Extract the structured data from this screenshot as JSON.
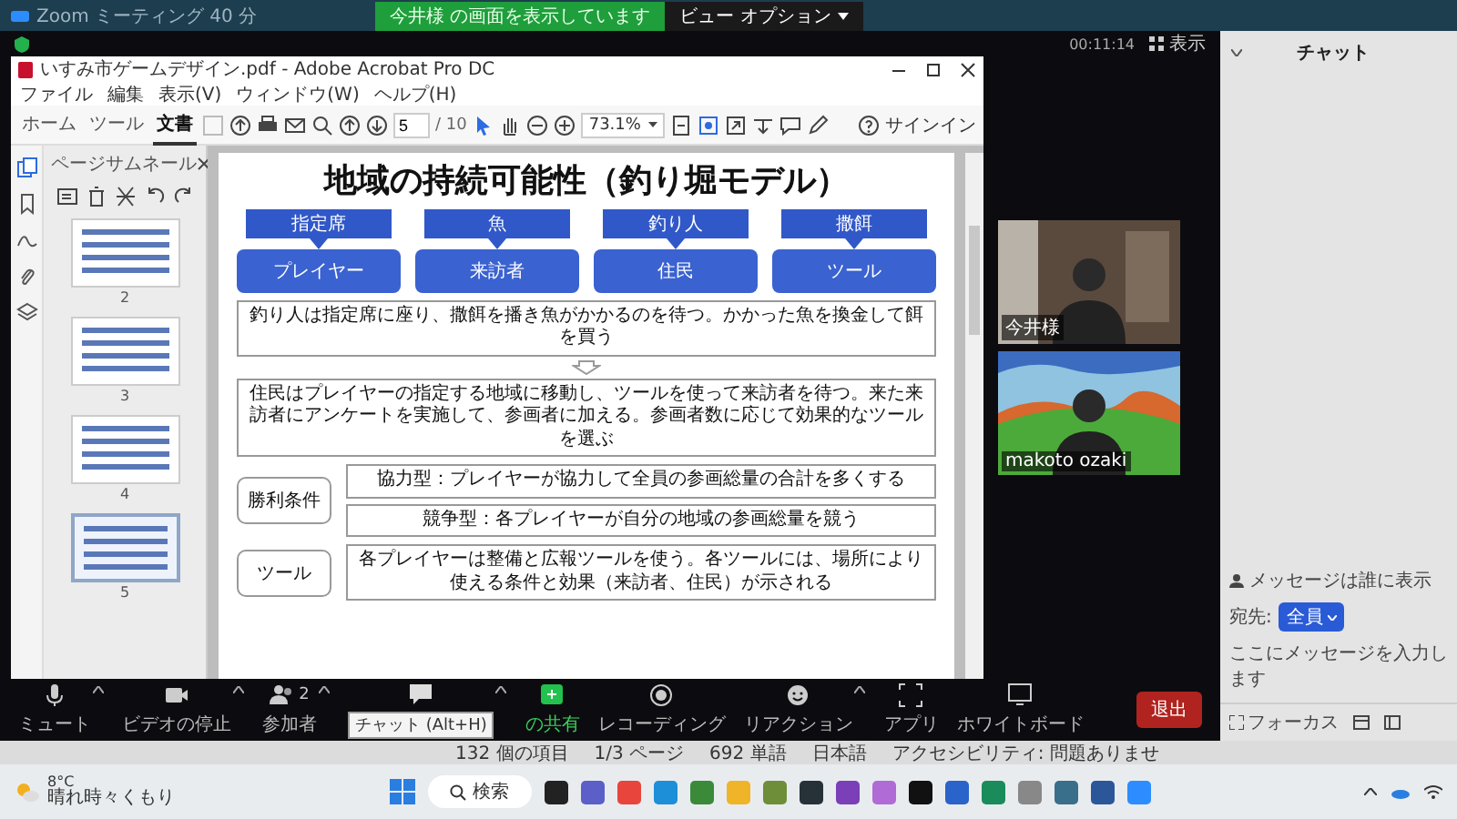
{
  "zoom": {
    "title": "Zoom ミーティング 40 分",
    "banner": "今井様 の画面を表示しています",
    "view_options": "ビュー オプション",
    "timer": "00:11:14",
    "view": "表示"
  },
  "acrobat": {
    "title": "いすみ市ゲームデザイン.pdf - Adobe Acrobat Pro DC",
    "menu": [
      "ファイル",
      "編集",
      "表示(V)",
      "ウィンドウ(W)",
      "ヘルプ(H)"
    ],
    "tabs": [
      {
        "label": "ホーム",
        "selected": false
      },
      {
        "label": "ツール",
        "selected": false
      },
      {
        "label": "文書",
        "selected": true
      }
    ],
    "page_current": "5",
    "page_total": "/ 10",
    "zoom_level": "73.1%",
    "sign_in": "サインイン",
    "sidebar_title": "ページサムネール",
    "thumbnails": [
      {
        "number": "2",
        "selected": false
      },
      {
        "number": "3",
        "selected": false
      },
      {
        "number": "4",
        "selected": false
      },
      {
        "number": "5",
        "selected": true
      }
    ]
  },
  "slide": {
    "title": "地域の持続可能性（釣り堀モデル）",
    "mappings": [
      {
        "from": "指定席",
        "to": "プレイヤー"
      },
      {
        "from": "魚",
        "to": "来訪者"
      },
      {
        "from": "釣り人",
        "to": "住民"
      },
      {
        "from": "撒餌",
        "to": "ツール"
      }
    ],
    "sentences": [
      "釣り人は指定席に座り、撒餌を播き魚がかかるのを待つ。かかった魚を換金して餌を買う",
      "住民はプレイヤーの指定する地域に移動し、ツールを使って来訪者を待つ。来た来訪者にアンケートを実施して、参画者に加える。参画者数に応じて効果的なツールを選ぶ"
    ],
    "conditions": [
      {
        "label": "勝利条件",
        "items": [
          "協力型：プレイヤーが協力して全員の参画総量の合計を多くする",
          "競争型：各プレイヤーが自分の地域の参画総量を競う"
        ]
      },
      {
        "label": "ツール",
        "items": [
          "各プレイヤーは整備と広報ツールを使う。各ツールには、場所により使える条件と効果（来訪者、住民）が示される"
        ]
      }
    ]
  },
  "video_tiles": [
    {
      "name": "今井様",
      "kind": "room"
    },
    {
      "name": "makoto ozaki",
      "kind": "landscape"
    }
  ],
  "toolbar": {
    "items": [
      {
        "kind": "mic",
        "label": "ミュート"
      },
      {
        "kind": "camera",
        "label": "ビデオの停止"
      },
      {
        "kind": "participants",
        "label": "参加者",
        "count": "2"
      },
      {
        "kind": "chat",
        "tooltip": "チャット (Alt+H)"
      },
      {
        "kind": "share",
        "label": "の共有"
      },
      {
        "kind": "record",
        "label": "レコーディング"
      },
      {
        "kind": "reaction",
        "label": "リアクション"
      },
      {
        "kind": "apps",
        "label": "アプリ"
      },
      {
        "kind": "whiteboard",
        "label": "ホワイトボード"
      }
    ],
    "end": "退出"
  },
  "chat": {
    "title": "チャット",
    "notice": "メッセージは誰に表示",
    "to_label": "宛先:",
    "recipient": "全員",
    "placeholder": "ここにメッセージを入力します",
    "focus": "フォーカス"
  },
  "status_bar": [
    "132 個の項目",
    "1/3 ページ",
    "692 単語",
    "日本語",
    "アクセシビリティ: 問題ありませ"
  ],
  "taskbar": {
    "temperature": "8°C",
    "weather": "晴れ時々くもり",
    "search": "検索"
  }
}
